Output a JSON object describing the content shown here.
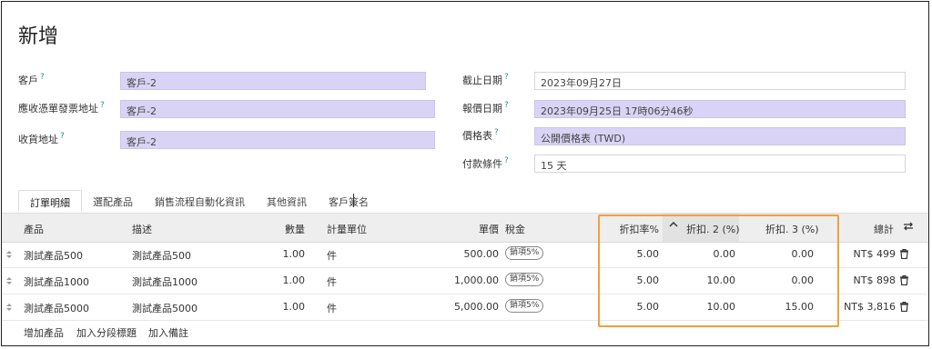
{
  "page": {
    "title": "新增"
  },
  "form": {
    "customer": {
      "label": "客戶",
      "value": "客戶-2"
    },
    "invoice_address": {
      "label": "應收憑單發票地址",
      "value": "客戶-2"
    },
    "delivery_address": {
      "label": "收貨地址",
      "value": "客戶-2"
    },
    "expiration": {
      "label": "截止日期",
      "value": "2023年09月27日"
    },
    "quotation_date": {
      "label": "報價日期",
      "value": "2023年09月25日 17時06分46秒"
    },
    "pricelist": {
      "label": "價格表",
      "value": "公開價格表 (TWD)"
    },
    "payment_terms": {
      "label": "付款條件",
      "value": "15 天"
    },
    "help_mark": "?"
  },
  "tabs": [
    "訂單明細",
    "選配產品",
    "銷售流程自動化資訊",
    "其他資訊",
    "客戶簽名"
  ],
  "table": {
    "headers": {
      "product": "產品",
      "description": "描述",
      "quantity": "數量",
      "uom": "計量單位",
      "unit_price": "單價",
      "taxes": "稅金",
      "disc_pct": "折扣率%",
      "disc2": "折扣. 2 (%)",
      "disc3": "折扣. 3 (%)",
      "total": "總計"
    },
    "rows": [
      {
        "product": "測試產品500",
        "description": "測試產品500",
        "quantity": "1.00",
        "uom": "件",
        "unit_price": "500.00",
        "tax": "銷項5%",
        "disc_pct": "5.00",
        "disc2": "0.00",
        "disc3": "0.00",
        "total": "NT$ 499"
      },
      {
        "product": "測試產品1000",
        "description": "測試產品1000",
        "quantity": "1.00",
        "uom": "件",
        "unit_price": "1,000.00",
        "tax": "銷項5%",
        "disc_pct": "5.00",
        "disc2": "10.00",
        "disc3": "0.00",
        "total": "NT$ 898"
      },
      {
        "product": "測試產品5000",
        "description": "測試產品5000",
        "quantity": "1.00",
        "uom": "件",
        "unit_price": "5,000.00",
        "tax": "銷項5%",
        "disc_pct": "5.00",
        "disc2": "10.00",
        "disc3": "15.00",
        "total": "NT$ 3,816"
      }
    ]
  },
  "actions": {
    "add_product": "增加產品",
    "add_section": "加入分段標題",
    "add_note": "加入備註"
  },
  "colors": {
    "required_field": "#d9d4f5",
    "highlight_box": "#f0a040",
    "help_mark": "#2c8d8a"
  }
}
